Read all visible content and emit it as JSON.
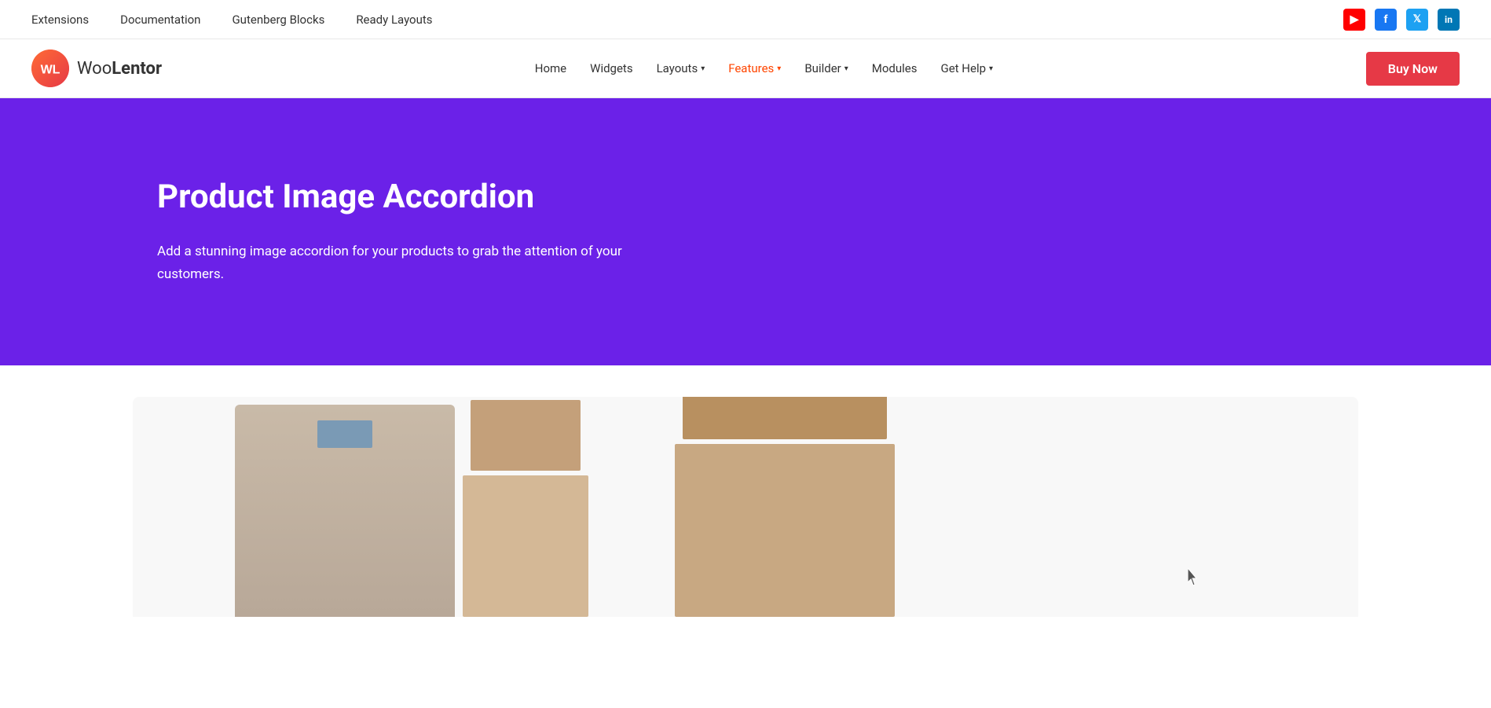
{
  "topbar": {
    "nav": [
      {
        "label": "Extensions",
        "href": "#"
      },
      {
        "label": "Documentation",
        "href": "#"
      },
      {
        "label": "Gutenberg Blocks",
        "href": "#"
      },
      {
        "label": "Ready Layouts",
        "href": "#"
      }
    ],
    "social": [
      {
        "name": "youtube",
        "icon": "▶",
        "color": "#ff0000",
        "label": "YouTube"
      },
      {
        "name": "facebook",
        "icon": "f",
        "color": "#1877f2",
        "label": "Facebook"
      },
      {
        "name": "twitter",
        "icon": "𝕏",
        "color": "#1da1f2",
        "label": "Twitter"
      },
      {
        "name": "linkedin",
        "icon": "in",
        "color": "#0077b5",
        "label": "LinkedIn"
      }
    ]
  },
  "mainnav": {
    "logo_text_part1": "Woo",
    "logo_text_part2": "Lentor",
    "logo_initials": "WL",
    "links": [
      {
        "label": "Home",
        "href": "#",
        "active": false,
        "hasDropdown": false
      },
      {
        "label": "Widgets",
        "href": "#",
        "active": false,
        "hasDropdown": false
      },
      {
        "label": "Layouts",
        "href": "#",
        "active": false,
        "hasDropdown": true
      },
      {
        "label": "Features",
        "href": "#",
        "active": true,
        "hasDropdown": true
      },
      {
        "label": "Builder",
        "href": "#",
        "active": false,
        "hasDropdown": true
      },
      {
        "label": "Modules",
        "href": "#",
        "active": false,
        "hasDropdown": false
      },
      {
        "label": "Get Help",
        "href": "#",
        "active": false,
        "hasDropdown": true
      }
    ],
    "buy_now_label": "Buy Now"
  },
  "hero": {
    "title": "Product Image Accordion",
    "description": "Add a stunning image accordion for your products to grab the attention of your customers.",
    "background_color": "#6b21e8"
  },
  "content": {
    "section_background": "#ffffff"
  }
}
